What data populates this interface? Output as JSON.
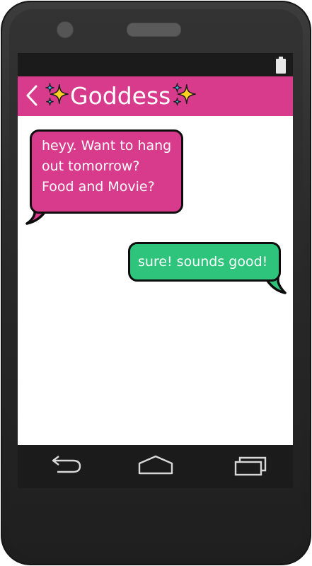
{
  "header": {
    "back_icon": "chevron-left-icon",
    "sparkle_icon": "sparkles-icon",
    "contact_name": "Goddess",
    "color": "#d83a8c"
  },
  "status_bar": {
    "battery_icon": "battery-icon"
  },
  "messages": [
    {
      "direction": "incoming",
      "lines": [
        "heyy. Want to hang",
        "out tomorrow?",
        "Food and Movie?"
      ],
      "color": "#d83a8c"
    },
    {
      "direction": "outgoing",
      "lines": [
        "sure! sounds good!"
      ],
      "color": "#2ec47c"
    }
  ],
  "nav_bar": {
    "back_icon": "nav-back-icon",
    "home_icon": "nav-home-icon",
    "recents_icon": "nav-recents-icon"
  }
}
